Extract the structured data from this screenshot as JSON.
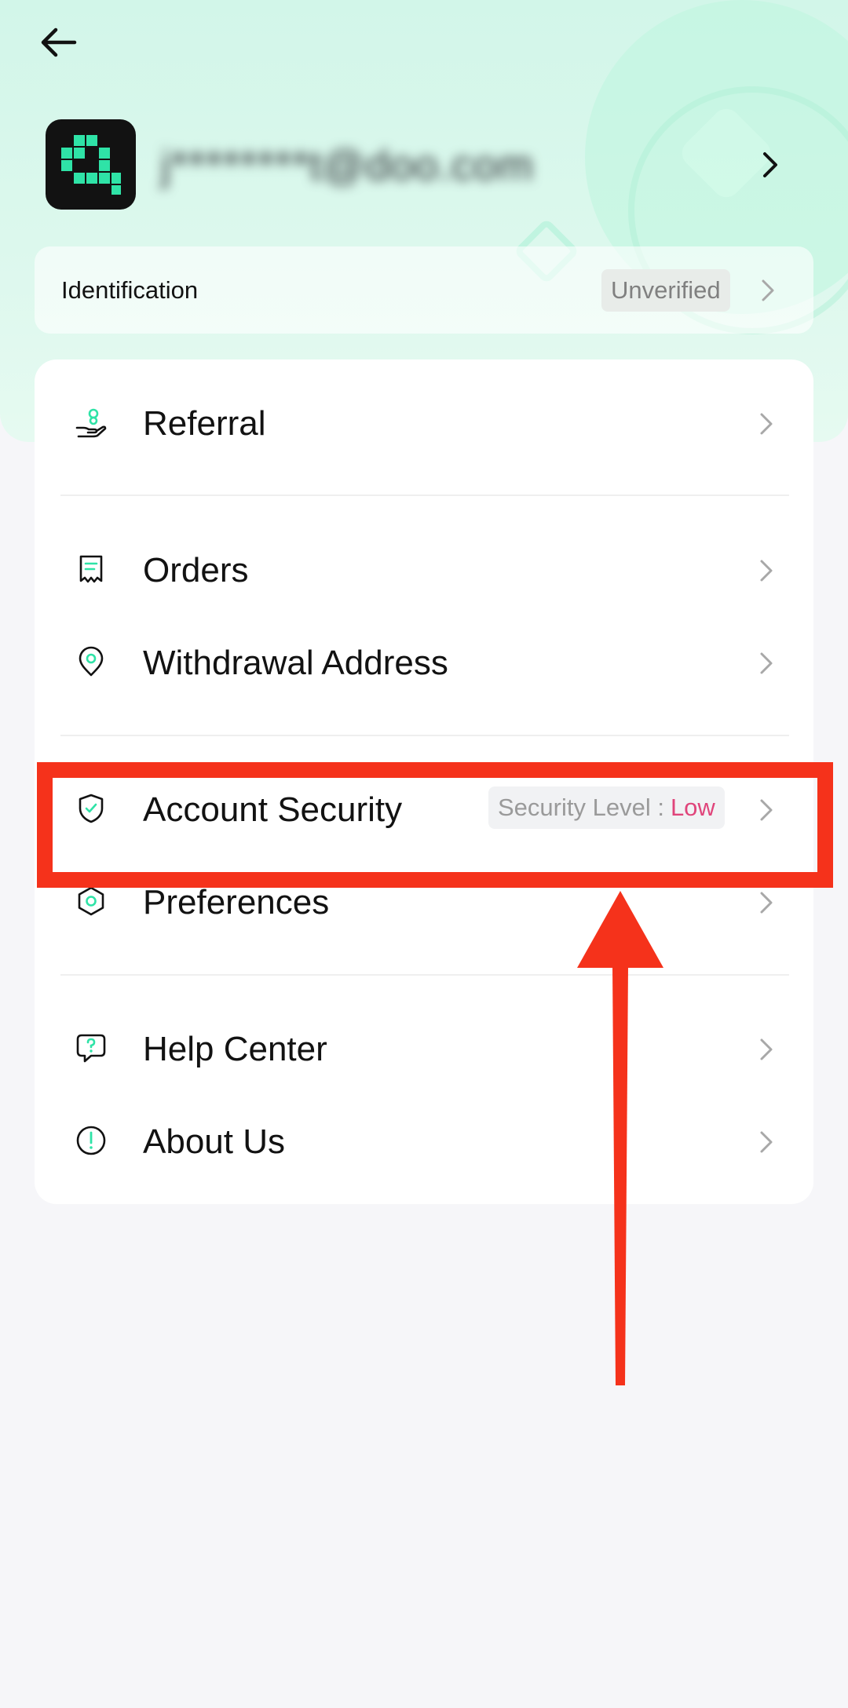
{
  "header": {
    "account_email": "j********t@doo.com"
  },
  "identification": {
    "label": "Identification",
    "status": "Unverified"
  },
  "menu": {
    "referral": "Referral",
    "orders": "Orders",
    "withdrawal_address": "Withdrawal Address",
    "account_security": "Account Security",
    "security_level_label": "Security Level :",
    "security_level_value": "Low",
    "preferences": "Preferences",
    "help_center": "Help Center",
    "about_us": "About Us"
  },
  "colors": {
    "accent": "#2fe3a7",
    "highlight_annotation": "#f5321b",
    "security_low": "#e0457b"
  }
}
